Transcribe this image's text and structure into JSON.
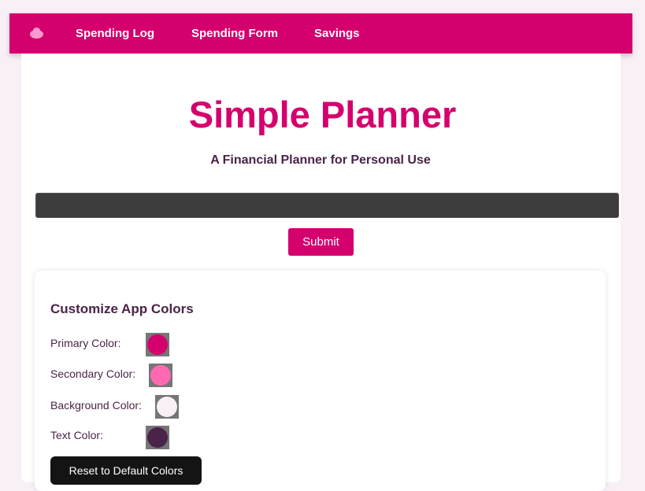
{
  "nav": {
    "logo_icon": "piggy-bank-icon",
    "links": [
      {
        "label": "Spending Log"
      },
      {
        "label": "Spending Form"
      },
      {
        "label": "Savings"
      }
    ]
  },
  "header": {
    "title": "Simple Planner",
    "subtitle": "A Financial Planner for Personal Use"
  },
  "form": {
    "input_value": "",
    "input_placeholder": "",
    "submit_label": "Submit"
  },
  "colors_panel": {
    "title": "Customize App Colors",
    "items": [
      {
        "label": "Primary Color:",
        "value": "#d4006d"
      },
      {
        "label": "Secondary Color:",
        "value": "#ff69b4"
      },
      {
        "label": "Background Color:",
        "value": "#f8f0f6"
      },
      {
        "label": "Text Color:",
        "value": "#4a2348"
      }
    ],
    "reset_label": "Reset to Default Colors"
  },
  "theme": {
    "primary": "#d4006d",
    "background": "#f8f0f6",
    "text": "#4a2348"
  }
}
